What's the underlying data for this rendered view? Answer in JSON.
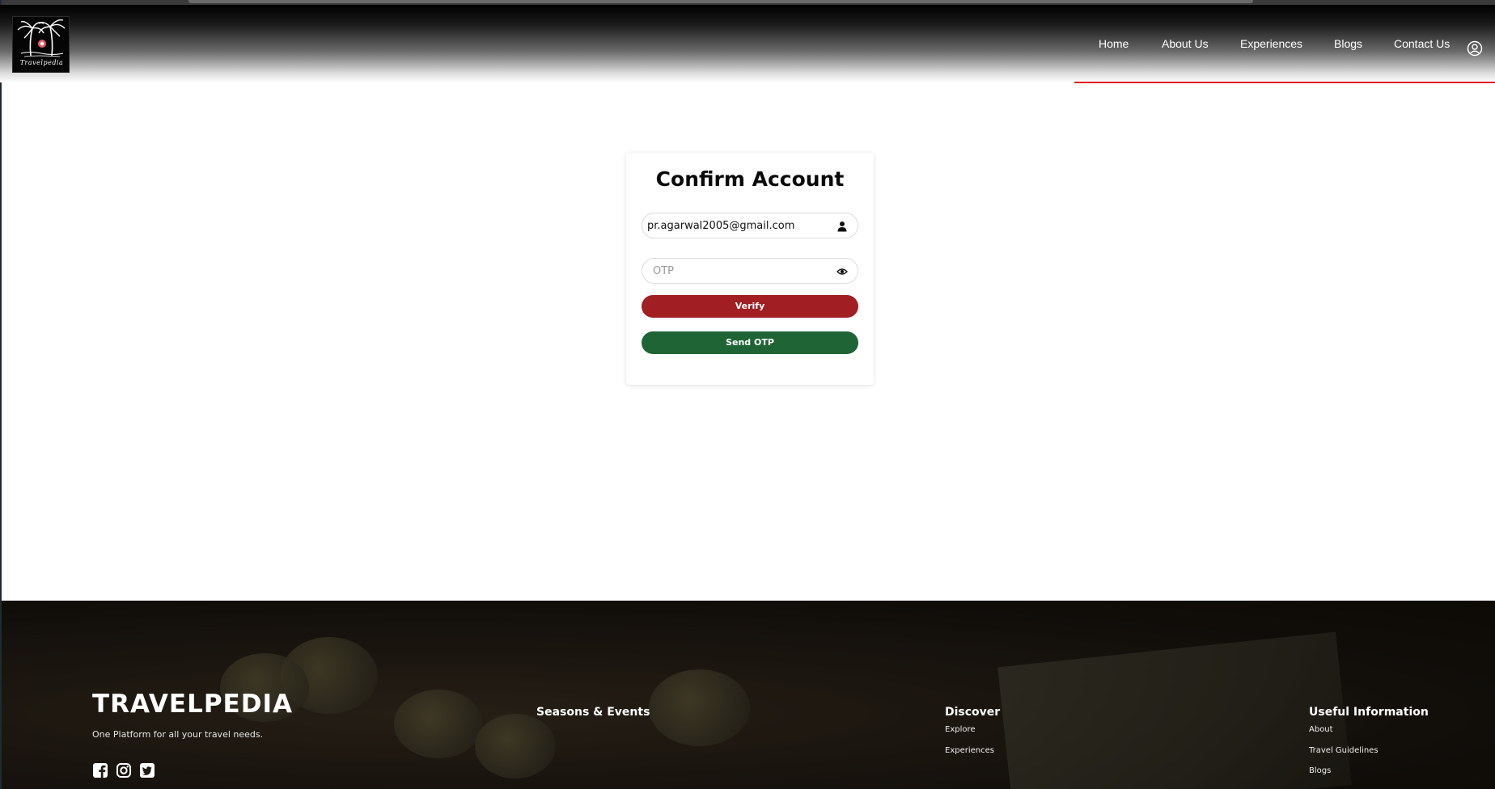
{
  "header": {
    "logo_text": "Travelpedia",
    "nav": [
      {
        "label": "Home"
      },
      {
        "label": "About Us"
      },
      {
        "label": "Experiences"
      },
      {
        "label": "Blogs"
      },
      {
        "label": "Contact Us"
      }
    ],
    "accent_color": "#e02020"
  },
  "card": {
    "title": "Confirm Account",
    "email_value": "pr.agarwal2005@gmail.com",
    "otp_placeholder": "OTP",
    "verify_label": "Verify",
    "send_otp_label": "Send OTP",
    "verify_color": "#a11e22",
    "send_otp_color": "#1e6434"
  },
  "footer": {
    "brand": "TRAVELPEDIA",
    "tagline": "One Platform for all your travel needs.",
    "social_icons": [
      "facebook-icon",
      "instagram-icon",
      "twitter-icon"
    ],
    "columns": [
      {
        "title": "Seasons & Events",
        "links": []
      },
      {
        "title": "Discover",
        "links": [
          "Explore",
          "Experiences"
        ]
      },
      {
        "title": "Useful Information",
        "links": [
          "About",
          "Travel Guidelines",
          "Blogs"
        ]
      }
    ]
  }
}
